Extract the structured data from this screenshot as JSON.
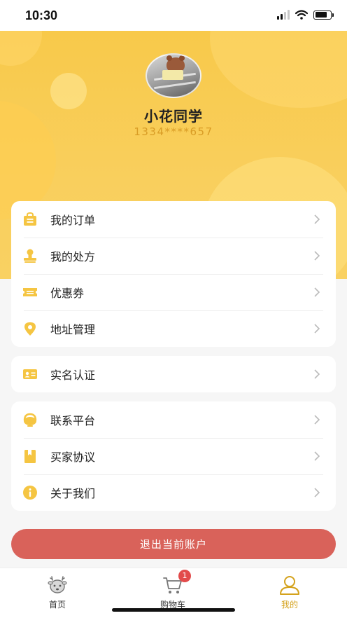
{
  "status_bar": {
    "time": "10:30"
  },
  "profile": {
    "name": "小花同学",
    "phone": "1334****657"
  },
  "menu_group_1": [
    {
      "label": "我的订单",
      "icon": "bag-icon"
    },
    {
      "label": "我的处方",
      "icon": "stamp-icon"
    },
    {
      "label": "优惠券",
      "icon": "ticket-icon"
    },
    {
      "label": "地址管理",
      "icon": "location-pin-icon"
    }
  ],
  "menu_group_2": [
    {
      "label": "实名认证",
      "icon": "id-card-icon"
    }
  ],
  "menu_group_3": [
    {
      "label": "联系平台",
      "icon": "headset-icon"
    },
    {
      "label": "买家协议",
      "icon": "bookmark-icon"
    },
    {
      "label": "关于我们",
      "icon": "info-icon"
    }
  ],
  "logout_label": "退出当前账户",
  "tabs": [
    {
      "label": "首页",
      "icon": "deer-icon"
    },
    {
      "label": "购物车",
      "icon": "cart-icon",
      "badge": "1"
    },
    {
      "label": "我的",
      "icon": "user-icon"
    }
  ],
  "colors": {
    "accent": "#f8c94a",
    "icon": "#f5c542",
    "active_tab": "#d4a21c",
    "logout": "#d9625a",
    "badge": "#e24b4b"
  }
}
